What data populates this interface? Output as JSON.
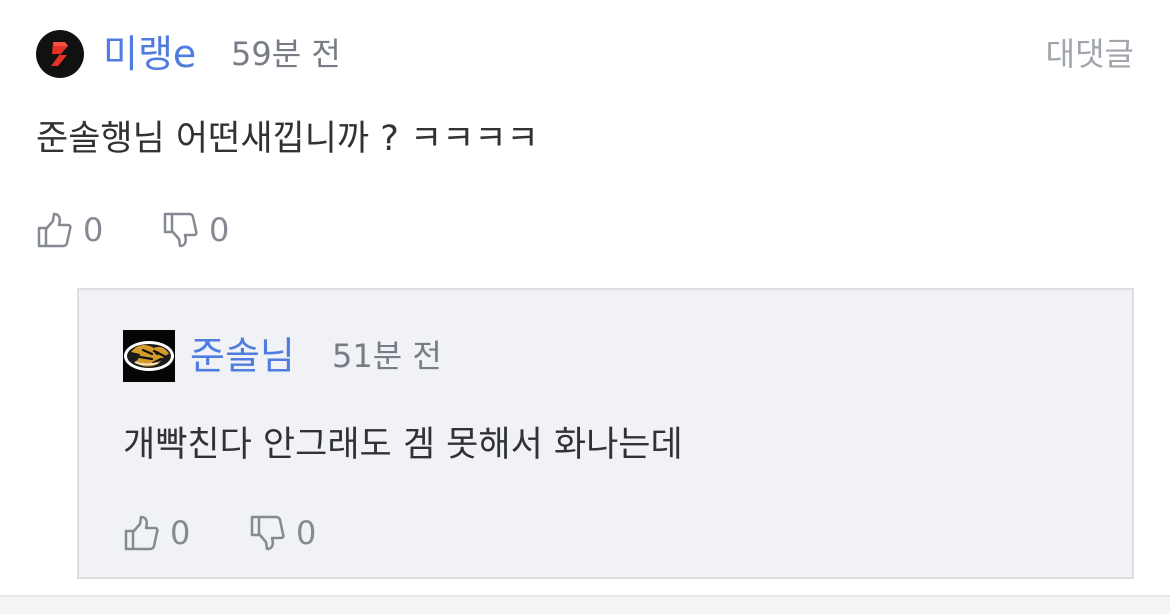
{
  "comment": {
    "username": "미랭e",
    "time": "59분 전",
    "reply_label": "대댓글",
    "text": "준솔행님 어떤새낍니까 ? ㅋㅋㅋㅋ",
    "likes": "0",
    "dislikes": "0"
  },
  "reply": {
    "username": "준솔님",
    "time": "51분 전",
    "text": "개빡친다 안그래도 겜 못해서 화나는데",
    "likes": "0",
    "dislikes": "0"
  },
  "icons": {
    "main_avatar": "red-slash-badge-avatar",
    "reply_avatar": "tiger-emblem-avatar",
    "like": "thumbs-up-icon",
    "dislike": "thumbs-down-icon"
  },
  "colors": {
    "username": "#4f7ce0",
    "text": "#303236",
    "muted": "#858991",
    "reply_background": "#f1f2f5",
    "avatar_red": "#e6332a"
  }
}
